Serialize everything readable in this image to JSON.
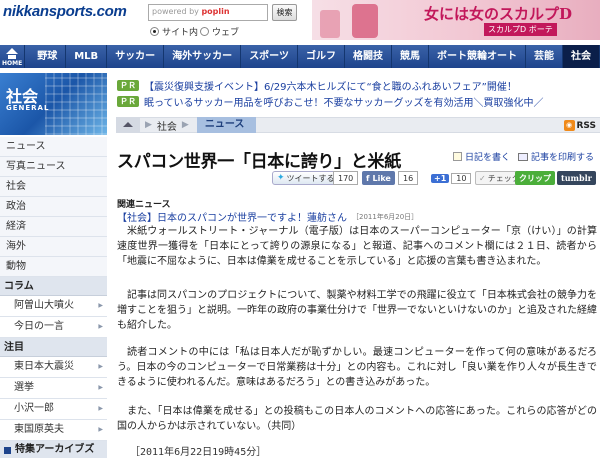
{
  "header": {
    "logo": "nikkansports.com",
    "search_placeholder": "powered by",
    "search_brand": "poplin",
    "search_button": "検索",
    "radio_site": "サイト内",
    "radio_web": "ウェブ"
  },
  "ad": {
    "title": "女には女のスカルプD",
    "subtitle": "スカルプD ボーテ"
  },
  "nav": {
    "home": "HOME",
    "items": [
      "野球",
      "MLB",
      "サッカー",
      "海外サッカー",
      "スポーツ",
      "ゴルフ",
      "格闘技",
      "競馬",
      "ボート競輪オート",
      "芸能",
      "社会"
    ]
  },
  "pr": [
    {
      "badge": "ＰＲ",
      "text": "【震災復興支援イベント】6/29六本木ヒルズにて“食と職のふれあいフェア”開催！"
    },
    {
      "badge": "ＰＲ",
      "text": "眠っているサッカー用品を呼びおこせ！不要なサッカーグッズを有効活用＼買取強化中／"
    }
  ],
  "section_banner": {
    "name": "社会",
    "sub": "GENERAL"
  },
  "sidebar": {
    "items": [
      "ニュース",
      "写真ニュース",
      "社会",
      "政治",
      "経済",
      "海外",
      "動物"
    ],
    "column_head": "コラム",
    "column_items": [
      "阿曽山大噴火",
      "今日の一言"
    ],
    "focus_head": "注目",
    "focus_items": [
      "東日本大震災",
      "選挙",
      "小沢一郎",
      "東国原英夫"
    ],
    "special": "特集アーカイブズ"
  },
  "breadcrumb": {
    "section": "社会",
    "current": "ニュース",
    "rss": "RSS"
  },
  "article": {
    "headline": "スパコン世界一「日本に誇り」と米紙",
    "diary_link": "日記を書く",
    "print_link": "記事を印刷する",
    "related_head": "関連ニュース",
    "related_link": "【社会】日本のスパコンが世界一ですよ！蓮舫さん",
    "related_date": "［2011年6月20日］",
    "paragraphs": [
      "米紙ウォールストリート・ジャーナル（電子版）は日本のスーパーコンピューター「京（けい）」の計算速度世界一獲得を「日本にとって誇りの源泉になる」と報道、記事へのコメント欄には２１日、読者から「地震に不屈なように、日本は偉業を成せることを示している」と応援の言葉も書き込まれた。",
      "記事は同スパコンのプロジェクトについて、製薬や材料工学での飛躍に役立て「日本株式会社の競争力を増すことを狙う」と説明。一昨年の政府の事業仕分けで「世界一でないといけないのか」と追及された経緯も紹介した。",
      "読者コメントの中には「私は日本人だが恥ずかしい。最速コンピューターを作って何の意味があるだろう。日本の今のコンピューターで日常業務は十分」との内容も。これに対し「良い業を作り人々が長生きできるように使われるんだ。意味はあるだろう」との書き込みがあった。",
      "また、「日本は偉業を成せる」との投稿もこの日本人のコメントへの応答にあった。これらの応答がどの国の人からかは示されていない。（共同）"
    ],
    "dateline": "［2011年6月22日19時45分］"
  },
  "social": {
    "tweet": "ツイートする",
    "tweet_count": "170",
    "fb_like": "Like",
    "fb_count": "16",
    "gplus_count": "10",
    "check": "チェック",
    "clip": "クリップ",
    "tumblr": "tumblr"
  }
}
